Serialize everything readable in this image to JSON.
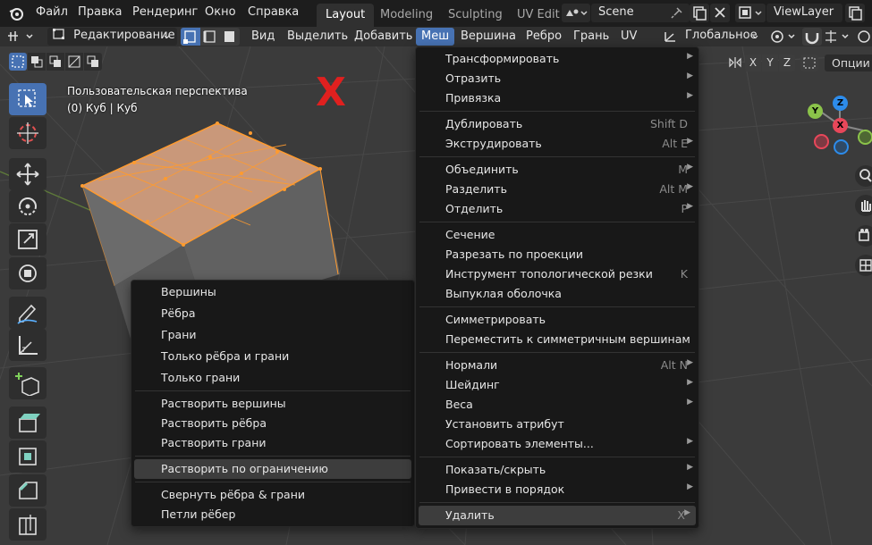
{
  "topbar": {
    "menu": [
      "Файл",
      "Правка",
      "Рендеринг",
      "Окно",
      "Справка"
    ],
    "workspaces": [
      "Layout",
      "Modeling",
      "Sculpting",
      "UV Edit"
    ],
    "active_workspace": "Layout",
    "scene": "Scene",
    "view_layer": "ViewLayer"
  },
  "header": {
    "mode": "Редактирование",
    "menus": [
      "Вид",
      "Выделить",
      "Добавить",
      "Меш",
      "Вершина",
      "Ребро",
      "Грань",
      "UV"
    ],
    "active_menu": "Меш",
    "orientation": "Глобальное",
    "axes": [
      "X",
      "Y",
      "Z"
    ],
    "options": "Опции"
  },
  "viewport": {
    "perspective": "Пользовательская перспектива",
    "object": "(0) Куб | Куб",
    "annotation": "X",
    "gizmo_axes": [
      "X",
      "Y",
      "Z"
    ]
  },
  "mesh_menu": {
    "items": [
      {
        "label": "Трансформировать",
        "shortcut": "",
        "submenu": true
      },
      {
        "label": "Отразить",
        "shortcut": "",
        "submenu": true
      },
      {
        "label": "Привязка",
        "shortcut": "",
        "submenu": true
      },
      {
        "label": "Дублировать",
        "shortcut": "Shift D",
        "submenu": false
      },
      {
        "label": "Экструдировать",
        "shortcut": "Alt E",
        "submenu": true
      },
      {
        "label": "Объединить",
        "shortcut": "M",
        "submenu": true
      },
      {
        "label": "Разделить",
        "shortcut": "Alt M",
        "submenu": true
      },
      {
        "label": "Отделить",
        "shortcut": "P",
        "submenu": true
      },
      {
        "label": "Сечение",
        "shortcut": "",
        "submenu": false
      },
      {
        "label": "Разрезать по проекции",
        "shortcut": "",
        "submenu": false
      },
      {
        "label": "Инструмент топологической резки",
        "shortcut": "K",
        "submenu": false
      },
      {
        "label": "Выпуклая оболочка",
        "shortcut": "",
        "submenu": false
      },
      {
        "label": "Симметрировать",
        "shortcut": "",
        "submenu": false
      },
      {
        "label": "Переместить к симметричным вершинам",
        "shortcut": "",
        "submenu": false
      },
      {
        "label": "Нормали",
        "shortcut": "Alt N",
        "submenu": true
      },
      {
        "label": "Шейдинг",
        "shortcut": "",
        "submenu": true
      },
      {
        "label": "Веса",
        "shortcut": "",
        "submenu": true
      },
      {
        "label": "Установить атрибут",
        "shortcut": "",
        "submenu": false
      },
      {
        "label": "Сортировать элементы...",
        "shortcut": "",
        "submenu": true
      },
      {
        "label": "Показать/скрыть",
        "shortcut": "",
        "submenu": true
      },
      {
        "label": "Привести в порядок",
        "shortcut": "",
        "submenu": true
      },
      {
        "label": "Удалить",
        "shortcut": "X",
        "submenu": true
      }
    ]
  },
  "delete_menu": {
    "items": [
      "Вершины",
      "Рёбра",
      "Грани",
      "Только рёбра и грани",
      "Только грани",
      "Растворить вершины",
      "Растворить рёбра",
      "Растворить грани",
      "Растворить по ограничению",
      "Свернуть рёбра & грани",
      "Петли рёбер"
    ]
  },
  "colors": {
    "accent": "#4772b3",
    "selection": "#ff9b2f",
    "x_axis": "#e8475a",
    "y_axis": "#8bc34a",
    "z_axis": "#2d8ceb",
    "annotation": "#e0201f"
  }
}
